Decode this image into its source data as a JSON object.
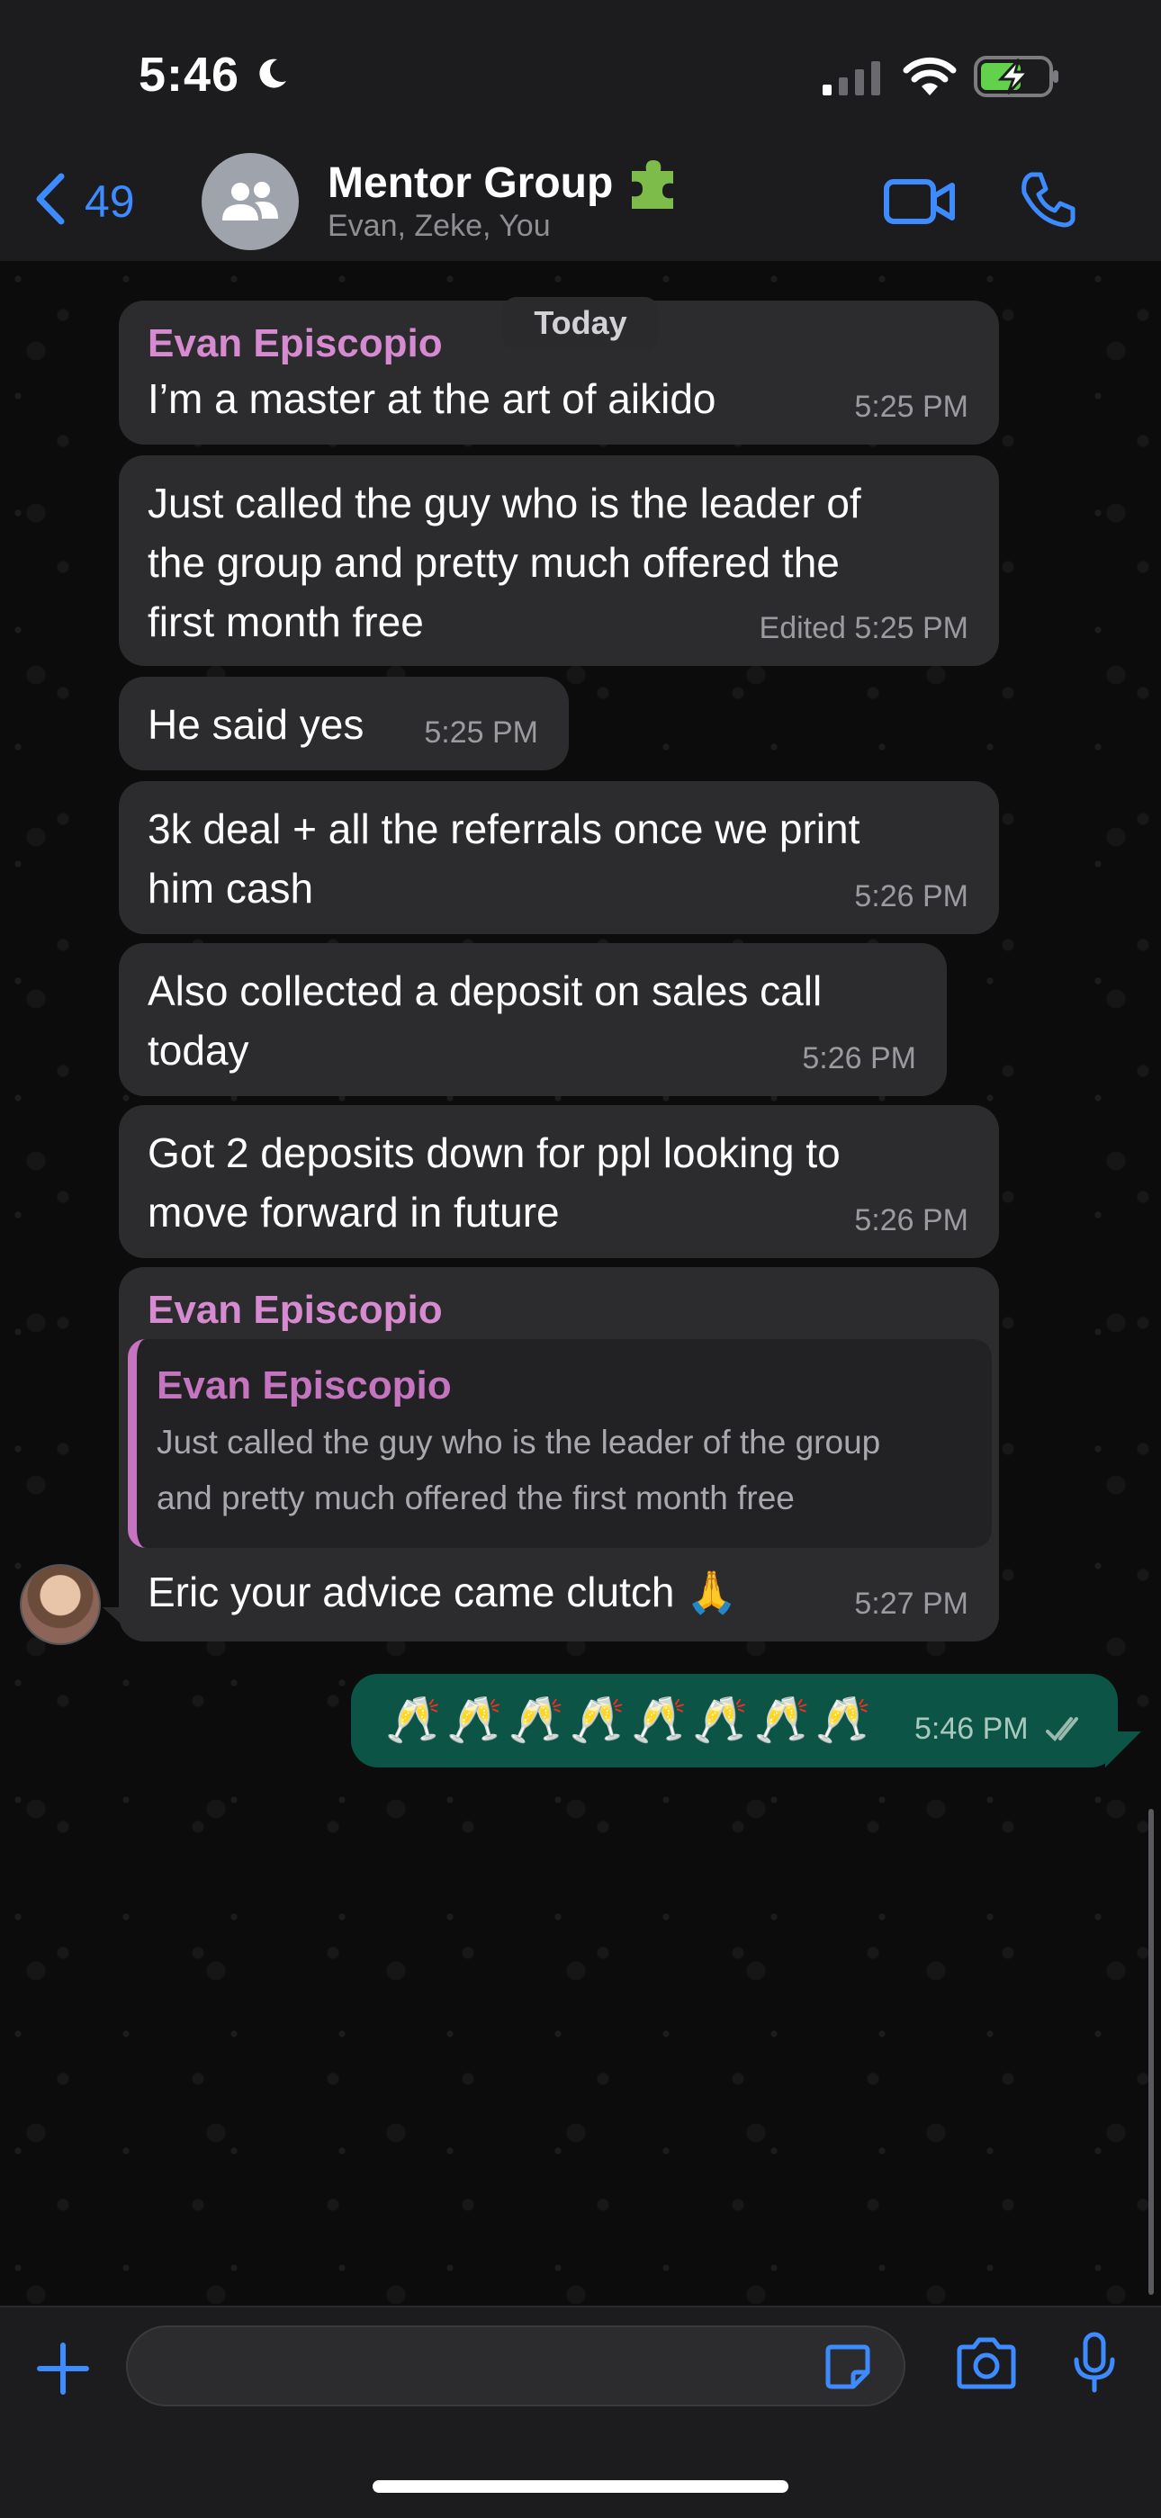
{
  "status_bar": {
    "time": "5:46"
  },
  "header": {
    "back_count": "49",
    "group_name": "Mentor Group",
    "members": "Evan, Zeke, You"
  },
  "date_pill": "Today",
  "messages": [
    {
      "sender": "Evan Episcopio",
      "text": "I’m a master at the art of aikido",
      "time": "5:25 PM"
    },
    {
      "text_lines": [
        "Just called the guy who is the leader of",
        "the group and pretty much offered the",
        "first month free"
      ],
      "time": "Edited 5:25 PM"
    },
    {
      "text": "He said yes",
      "time": "5:25 PM"
    },
    {
      "text_lines": [
        "3k deal + all the referrals once we print",
        "him cash"
      ],
      "time": "5:26 PM"
    },
    {
      "text_lines": [
        "Also collected a deposit on sales call",
        "today"
      ],
      "time": "5:26 PM"
    },
    {
      "text_lines": [
        "Got 2 deposits down for ppl looking to",
        "move forward in future"
      ],
      "time": "5:26 PM"
    },
    {
      "sender": "Evan Episcopio",
      "quote": {
        "sender": "Evan Episcopio",
        "text_lines": [
          "Just called the guy who is the leader of the group",
          "and pretty much offered the first month free"
        ]
      },
      "text": "Eric your advice came clutch 🙏",
      "time": "5:27 PM"
    }
  ],
  "sent_message": {
    "text": "🥂🥂🥂🥂🥂🥂🥂🥂",
    "time": "5:46 PM",
    "status": "read"
  },
  "input": {
    "value": "",
    "placeholder": ""
  },
  "colors": {
    "accent": "#3d8bff",
    "sender": "#d68bd0",
    "sent_bubble": "#0c5546",
    "received_bubble": "#2c2c2e"
  }
}
